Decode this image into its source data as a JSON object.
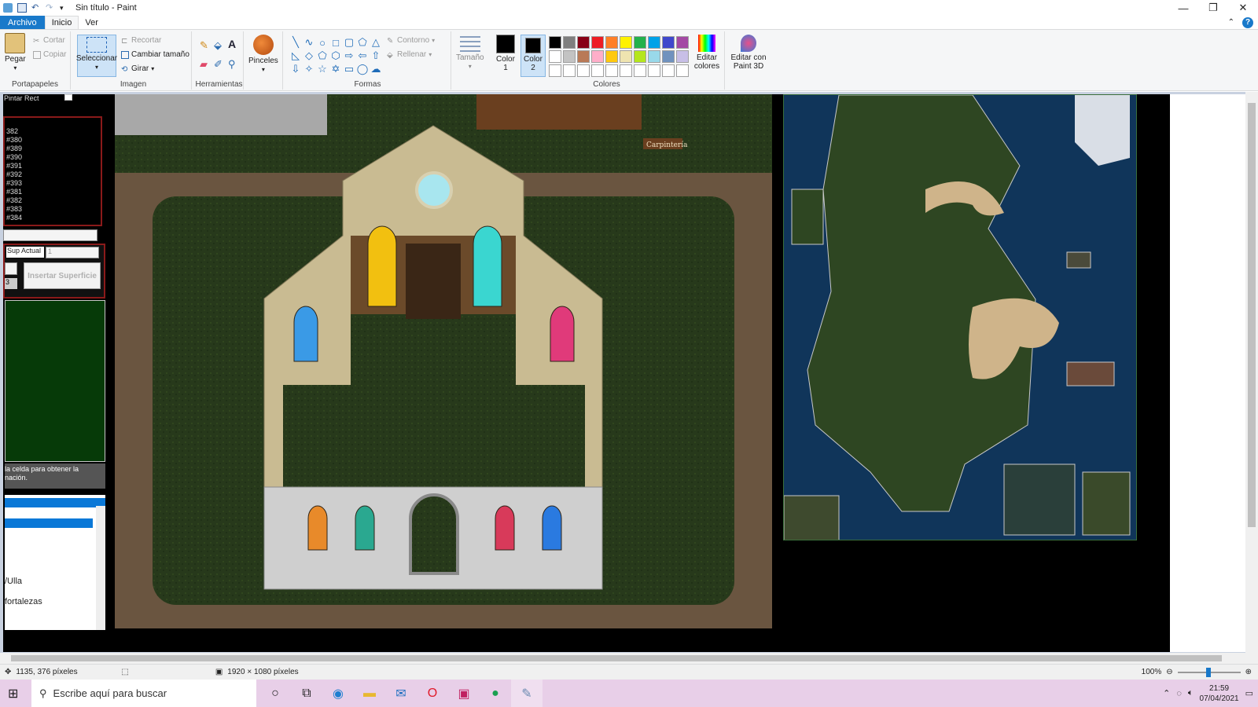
{
  "window": {
    "title": "Sin título - Paint",
    "controls": [
      "—",
      "❐",
      "✕"
    ]
  },
  "tabs": [
    "Archivo",
    "Inicio",
    "Ver"
  ],
  "ribbon": {
    "clipboard": {
      "paste": "Pegar",
      "cut": "Cortar",
      "copy": "Copiar",
      "label": "Portapapeles"
    },
    "image": {
      "select": "Seleccionar",
      "crop": "Recortar",
      "resize": "Cambiar tamaño",
      "rotate": "Girar",
      "label": "Imagen"
    },
    "tools": {
      "label": "Herramientas"
    },
    "brushes": {
      "label": "Pinceles"
    },
    "shapes": {
      "outline": "Contorno",
      "fill": "Rellenar",
      "label": "Formas"
    },
    "size": {
      "label": "Tamaño"
    },
    "colors": {
      "color1": "Color 1",
      "color2": "Color 2",
      "edit": "Editar colores",
      "paint3d": "Editar con Paint 3D",
      "label": "Colores",
      "palette": [
        "#000000",
        "#7f7f7f",
        "#880015",
        "#ed1c24",
        "#ff7f27",
        "#fff200",
        "#22b14c",
        "#00a2e8",
        "#3f48cc",
        "#a349a4",
        "#ffffff",
        "#c3c3c3",
        "#b97a57",
        "#ffaec9",
        "#ffc90e",
        "#efe4b0",
        "#b5e61d",
        "#99d9ea",
        "#7092be",
        "#c8bfe7",
        "#ffffff",
        "#ffffff",
        "#ffffff",
        "#ffffff",
        "#ffffff",
        "#ffffff",
        "#ffffff",
        "#ffffff",
        "#ffffff",
        "#ffffff"
      ]
    }
  },
  "editor_panel": {
    "title": "Pintar Rect",
    "list_items": [
      "382",
      "#380",
      "#389",
      "#390",
      "#391",
      "#392",
      "#393",
      "#381",
      "#382",
      "#383",
      "#384"
    ],
    "sup_actual_label": "Sup Actual",
    "sup_actual_value": "1",
    "small_value": "3",
    "insert_button": "Insertar Superficie",
    "info_text": "la celda para obtener la nación.",
    "list2_items": [
      "/Ulla",
      "fortalezas"
    ]
  },
  "game_labels": {
    "carpinteria": "Carpintería"
  },
  "status": {
    "cursor": "1135, 376 píxeles",
    "dimensions": "1920 × 1080 píxeles",
    "zoom": "100%"
  },
  "taskbar": {
    "search_placeholder": "Escribe aquí para buscar",
    "time": "21:59",
    "date": "07/04/2021"
  }
}
